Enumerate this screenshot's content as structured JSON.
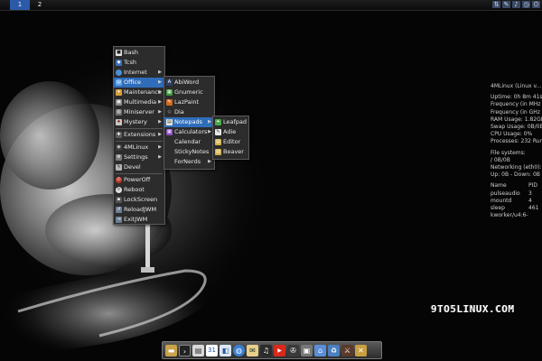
{
  "topbar": {
    "workspaces": [
      "1",
      "2"
    ],
    "tray_icons": [
      "network-icon",
      "tool-icon",
      "sound-icon",
      "clock-icon",
      "power-icon"
    ]
  },
  "main_menu": {
    "items": [
      "Bash",
      "Tcsh",
      "Internet",
      "Office",
      "Maintenance",
      "Multimedia",
      "Miniserver",
      "Mystery",
      "Extensions",
      "4MLinux",
      "Settings",
      "Devel",
      "PowerOff",
      "Reboot",
      "LockScreen",
      "ReloadJWM",
      "ExitJWM"
    ]
  },
  "office_menu": {
    "items": [
      "AbiWord",
      "Gnumeric",
      "LazPaint",
      "Dia",
      "Notepads",
      "Calculators",
      "Calendar",
      "StickyNotes",
      "ForNerds"
    ]
  },
  "notepads_menu": {
    "items": [
      "Leafpad",
      "Adie",
      "Editor",
      "Beaver"
    ]
  },
  "sysinfo": {
    "title": "4MLinux (Linux v...",
    "uptime": "Uptime: 0h 8m 41s",
    "freq1": "Frequency (in MHz",
    "freq2": "Frequency (in GHz",
    "ram": "RAM Usage: 1.82GB",
    "swap": "Swap Usage: 0B/0B",
    "cpu": "CPU Usage: 0%",
    "processes": "Processes: 232  Run",
    "fs_title": "File systems:",
    "fs_root": " / 0B/0B",
    "net_title": "Networking (eth0):",
    "net_line": "Up: 0B  - Down: 0B",
    "proc_header": [
      "Name",
      "PID"
    ],
    "proc_rows": [
      [
        "pulseaudio",
        "3"
      ],
      [
        "mountd",
        "4"
      ],
      [
        "sleep",
        "461"
      ],
      [
        "kworker/u4:6-tt",
        ""
      ]
    ]
  },
  "watermark": "9TO5LINUX.COM",
  "dock": {
    "icons": [
      "folder-icon",
      "terminal-icon",
      "notes-icon",
      "calendar-icon",
      "browser-icon",
      "globe-icon",
      "mail-icon",
      "music-icon",
      "youtube-icon",
      "film-icon",
      "media-icon",
      "home-icon",
      "recycle-icon",
      "game-icon",
      "tools-icon"
    ]
  },
  "colors": {
    "menu_bg": "#2c2c2c",
    "highlight": "#2f6dbb",
    "workspace_active": "#2b5aa8"
  }
}
